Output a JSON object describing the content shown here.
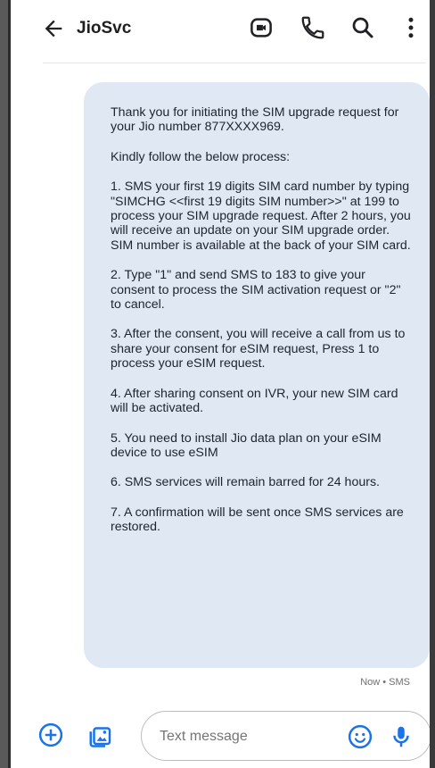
{
  "header": {
    "title": "JioSvc",
    "icons": [
      "back-arrow-icon",
      "video-call-icon",
      "phone-icon",
      "search-icon",
      "more-vert-icon"
    ]
  },
  "message": {
    "paragraphs": [
      "Thank you for initiating the SIM upgrade request for your Jio number 877XXXX969.",
      "Kindly follow the below process:",
      "1. SMS your first 19 digits SIM card number by typing \"SIMCHG <<first 19 digits SIM number>>\" at 199 to process your SIM upgrade request. After 2 hours, you will receive an update on your SIM upgrade order. SIM number is available at the back of your SIM card.",
      "2. Type \"1\" and send SMS to 183 to give your consent to process the SIM activation request or \"2\" to cancel.",
      "3. After the consent, you will receive a call from us to share your consent for eSIM request, Press 1 to process your eSIM request.",
      "4. After sharing consent on IVR, your new SIM card will be activated.",
      "5. You need to install Jio data plan on your eSIM device to use eSIM",
      "6. SMS services will remain barred for 24 hours.",
      "7. A confirmation will be sent once SMS services are restored."
    ],
    "meta": "Now • SMS"
  },
  "composer": {
    "placeholder": "Text message",
    "icons": [
      "add-icon",
      "gallery-icon",
      "emoji-icon",
      "mic-icon"
    ]
  },
  "colors": {
    "bubble": "#dfe8f3",
    "accent": "#1a73e8"
  }
}
